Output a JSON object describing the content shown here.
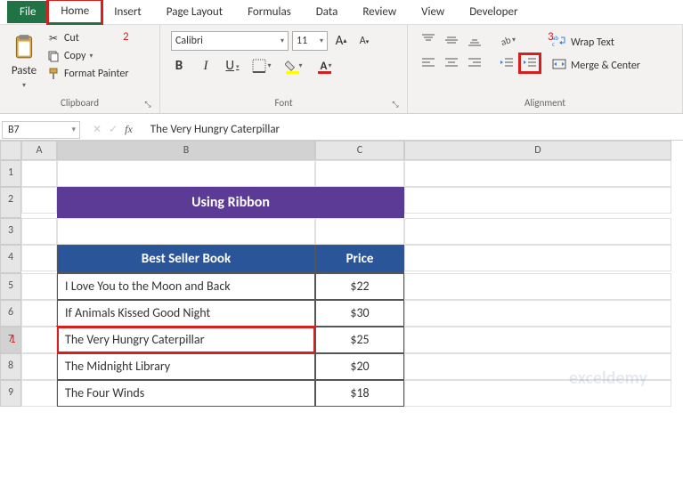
{
  "tabs": [
    "File",
    "Home",
    "Insert",
    "Page Layout",
    "Formulas",
    "Data",
    "Review",
    "View",
    "Developer"
  ],
  "activeTab": "Home",
  "annotations": {
    "step1": "1",
    "step2": "2",
    "step3": "3"
  },
  "clipboard": {
    "groupLabel": "Clipboard",
    "paste": "Paste",
    "cut": "Cut",
    "copy": "Copy",
    "formatPainter": "Format Painter"
  },
  "font": {
    "groupLabel": "Font",
    "name": "Calibri",
    "size": "11",
    "increaseLabel": "A▴",
    "decreaseLabel": "A▾",
    "bold": "B",
    "italic": "I",
    "underline": "U"
  },
  "alignment": {
    "groupLabel": "Alignment",
    "wrapText": "Wrap Text",
    "mergeCenter": "Merge & Center"
  },
  "nameBox": "B7",
  "formulaValue": "The Very Hungry Caterpillar",
  "columns": [
    "A",
    "B",
    "C",
    "D"
  ],
  "rows": [
    "1",
    "2",
    "3",
    "4",
    "5",
    "6",
    "7",
    "8",
    "9"
  ],
  "sheetTitle": "Using Ribbon",
  "tableHeaders": {
    "book": "Best Seller Book",
    "price": "Price"
  },
  "tableData": [
    {
      "book": "I Love You to the Moon and Back",
      "price": "$22"
    },
    {
      "book": "If Animals Kissed Good Night",
      "price": "$30"
    },
    {
      "book": "The Very Hungry Caterpillar",
      "price": "$25"
    },
    {
      "book": "The Midnight Library",
      "price": "$20"
    },
    {
      "book": "The Four Winds",
      "price": "$18"
    }
  ],
  "watermark": "exceldemy"
}
